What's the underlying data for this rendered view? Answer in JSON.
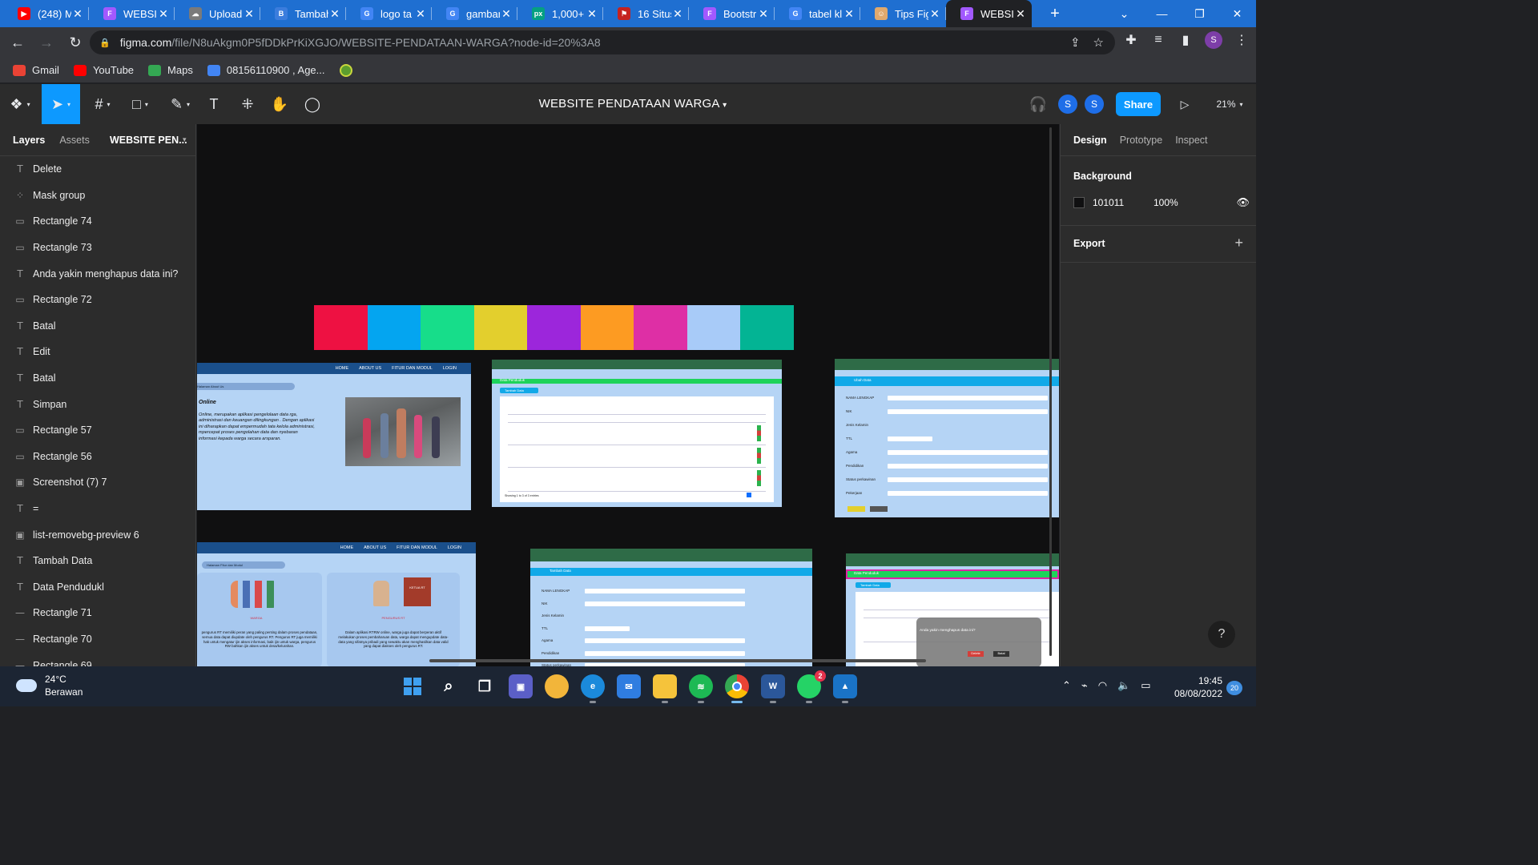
{
  "browser": {
    "tabs": [
      {
        "title": "(248) M",
        "icon": "youtube-icon",
        "color": "#ff0000",
        "glyph": "▶"
      },
      {
        "title": "WEBSIT",
        "icon": "figma-icon",
        "color": "#a259ff",
        "glyph": "F"
      },
      {
        "title": "Upload",
        "icon": "cloud-icon",
        "color": "#7a7a7a",
        "glyph": "☁"
      },
      {
        "title": "Tambah",
        "icon": "bootstrap-icon",
        "color": "#3b7ddd",
        "glyph": "B"
      },
      {
        "title": "logo ta",
        "icon": "google-icon",
        "color": "#4285f4",
        "glyph": "G"
      },
      {
        "title": "gambar",
        "icon": "google-icon",
        "color": "#4285f4",
        "glyph": "G"
      },
      {
        "title": "1,000+",
        "icon": "pexels-icon",
        "color": "#05a081",
        "glyph": "px"
      },
      {
        "title": "16 Situs",
        "icon": "bookmark-icon",
        "color": "#c5221f",
        "glyph": "⚑"
      },
      {
        "title": "Bootstr",
        "icon": "figma-icon",
        "color": "#a259ff",
        "glyph": "F"
      },
      {
        "title": "tabel kl",
        "icon": "google-icon",
        "color": "#4285f4",
        "glyph": "G"
      },
      {
        "title": "Tips Fig",
        "icon": "photo-icon",
        "color": "#e0a96d",
        "glyph": "☺"
      },
      {
        "title": "WEBSIT",
        "icon": "figma-icon",
        "color": "#a259ff",
        "glyph": "F",
        "active": true
      }
    ],
    "url_host": "figma.com",
    "url_path": "/file/N8uAkgm0P5fDDkPrKiXGJO/WEBSITE-PENDATAAN-WARGA?node-id=20%3A8",
    "profile_initial": "S",
    "bookmarks": [
      {
        "label": "Gmail",
        "icon": "gmail-icon",
        "color": "#ea4335"
      },
      {
        "label": "YouTube",
        "icon": "youtube-icon",
        "color": "#ff0000"
      },
      {
        "label": "Maps",
        "icon": "maps-icon",
        "color": "#34a853"
      },
      {
        "label": "08156110900 , Age...",
        "icon": "globe-icon",
        "color": "#4285f4"
      }
    ]
  },
  "figma": {
    "file_title": "WEBSITE PENDATAAN WARGA",
    "zoom": "21%",
    "share_label": "Share",
    "avatar_initial": "S",
    "left_tabs": {
      "layers": "Layers",
      "assets": "Assets",
      "page": "WEBSITE PEN..."
    },
    "layers": [
      {
        "name": "Delete",
        "type": "text",
        "glyph": "T"
      },
      {
        "name": "Mask group",
        "type": "mask",
        "glyph": "⁘"
      },
      {
        "name": "Rectangle 74",
        "type": "rect",
        "glyph": "▭"
      },
      {
        "name": "Rectangle 73",
        "type": "rect",
        "glyph": "▭"
      },
      {
        "name": "Anda yakin menghapus data ini?",
        "type": "text",
        "glyph": "T"
      },
      {
        "name": "Rectangle 72",
        "type": "rect",
        "glyph": "▭"
      },
      {
        "name": "Batal",
        "type": "text",
        "glyph": "T"
      },
      {
        "name": "Edit",
        "type": "text",
        "glyph": "T"
      },
      {
        "name": "Batal",
        "type": "text",
        "glyph": "T"
      },
      {
        "name": "Simpan",
        "type": "text",
        "glyph": "T"
      },
      {
        "name": "Rectangle 57",
        "type": "rect",
        "glyph": "▭"
      },
      {
        "name": "Rectangle 56",
        "type": "rect",
        "glyph": "▭"
      },
      {
        "name": "Screenshot (7) 7",
        "type": "image",
        "glyph": "▣"
      },
      {
        "name": "=",
        "type": "text",
        "glyph": "T"
      },
      {
        "name": "list-removebg-preview 6",
        "type": "image",
        "glyph": "▣"
      },
      {
        "name": "Tambah Data",
        "type": "text",
        "glyph": "T"
      },
      {
        "name": "Data Pendudukl",
        "type": "text",
        "glyph": "T"
      },
      {
        "name": "Rectangle 71",
        "type": "line",
        "glyph": "—"
      },
      {
        "name": "Rectangle 70",
        "type": "line",
        "glyph": "—"
      },
      {
        "name": "Rectangle 69",
        "type": "line",
        "glyph": "—"
      }
    ],
    "right_tabs": {
      "design": "Design",
      "prototype": "Prototype",
      "inspect": "Inspect"
    },
    "background_label": "Background",
    "background_hex": "101011",
    "background_opacity": "100%",
    "export_label": "Export",
    "palette": [
      "#ee1142",
      "#04a5f0",
      "#17dd8a",
      "#e3cf2d",
      "#9c26db",
      "#fd9b22",
      "#de2fa5",
      "#a8cbf8",
      "#03b494"
    ],
    "mock": {
      "nav": [
        "HOME",
        "ABOUT US",
        "FITUR DAN MODUL",
        "LOGIN"
      ],
      "about_title": "Online",
      "about_pill": "Halaman About Us",
      "about_text": "Online, merupakan aplikasi pengelolaan data rga, administrasi dan keuangan dilingkungan . Dengan aplikasi ini diharapkan dapat empermudah tata kelola administrasi, mpercepat proses pengolahan data dan nyebaran informasi kepada warga secara arsparan.",
      "fitur_pill": "Halaman Fitur dan Modul",
      "card1_label": "WARGA",
      "card1_text": "pengurus RT memiliki peran yang paling penting dalam proses pendataan, semua data dapat diupdate oleh pengurus RT. Pengurus RT juga memiliki hak untuk mengatur ijin akses informasi, baik ijin untuk warga, pengurus RW bahkan ijin akses untuk desa/kelurahan.",
      "card2_label": "PENGURUS RT",
      "card2_sign": "KETUA RT",
      "card2_text": "Dalam aplikasi RTRW online, warga juga dapat berperan aktif melakukan proses pembaharuan data, warga dapat mengupdate data-data yang sifatnya pribadi yang sewaktu akan menghasilkan data valid yang dapat diakses oleh pengurus RT.",
      "data_title": "Data Penduduk",
      "tambah_data": "Tambah Data",
      "ubah_data": "Ubah Data",
      "form_labels": [
        "NAMA LENGKAP",
        "NIK",
        "Jenis Kelamin",
        "TTL",
        "Agama",
        "Pendidikan",
        "Status perkawinan",
        "Pekerjaan"
      ],
      "delete_prompt": "Anda yakin menghapus data ini?",
      "delete_btn": "Delete",
      "cancel_btn": "Batal",
      "showing": "Showing 1 to 3 of 3 entries"
    },
    "help_label": "?"
  },
  "taskbar": {
    "temp": "24°C",
    "weather": "Berawan",
    "time": "19:45",
    "date": "08/08/2022",
    "notifications": "20",
    "whatsapp_badge": "2"
  }
}
